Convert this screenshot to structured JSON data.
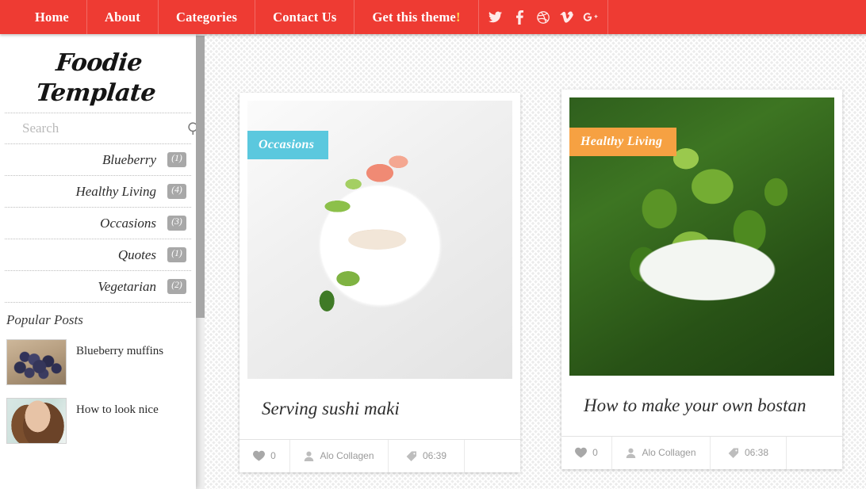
{
  "nav": {
    "items": [
      {
        "label": "Home"
      },
      {
        "label": "About"
      },
      {
        "label": "Categories"
      },
      {
        "label": "Contact Us"
      },
      {
        "label": "Get this theme",
        "bang": "!"
      }
    ],
    "social": [
      {
        "name": "twitter-icon"
      },
      {
        "name": "facebook-icon"
      },
      {
        "name": "dribbble-icon"
      },
      {
        "name": "vimeo-icon"
      },
      {
        "name": "googleplus-icon"
      }
    ],
    "background": "#ee3b33"
  },
  "sidebar": {
    "logo_line1": "Foodie",
    "logo_line2": "Template",
    "search": {
      "placeholder": "Search",
      "value": ""
    },
    "categories": [
      {
        "label": "Blueberry",
        "count": "(1)"
      },
      {
        "label": "Healthy Living",
        "count": "(4)"
      },
      {
        "label": "Occasions",
        "count": "(3)"
      },
      {
        "label": "Quotes",
        "count": "(1)"
      },
      {
        "label": "Vegetarian",
        "count": "(2)"
      }
    ],
    "popular_heading": "Popular Posts",
    "popular_posts": [
      {
        "title": "Blueberry muffins"
      },
      {
        "title": "How to look nice"
      }
    ]
  },
  "posts": [
    {
      "ribbon": "Occasions",
      "ribbon_color": "#5bc8de",
      "title": "Serving sushi maki",
      "likes": "0",
      "author": "Alo Collagen",
      "time": "06:39"
    },
    {
      "ribbon": "Healthy Living",
      "ribbon_color": "#f6a142",
      "title": "How to make your own bostan",
      "likes": "0",
      "author": "Alo Collagen",
      "time": "06:38"
    }
  ]
}
